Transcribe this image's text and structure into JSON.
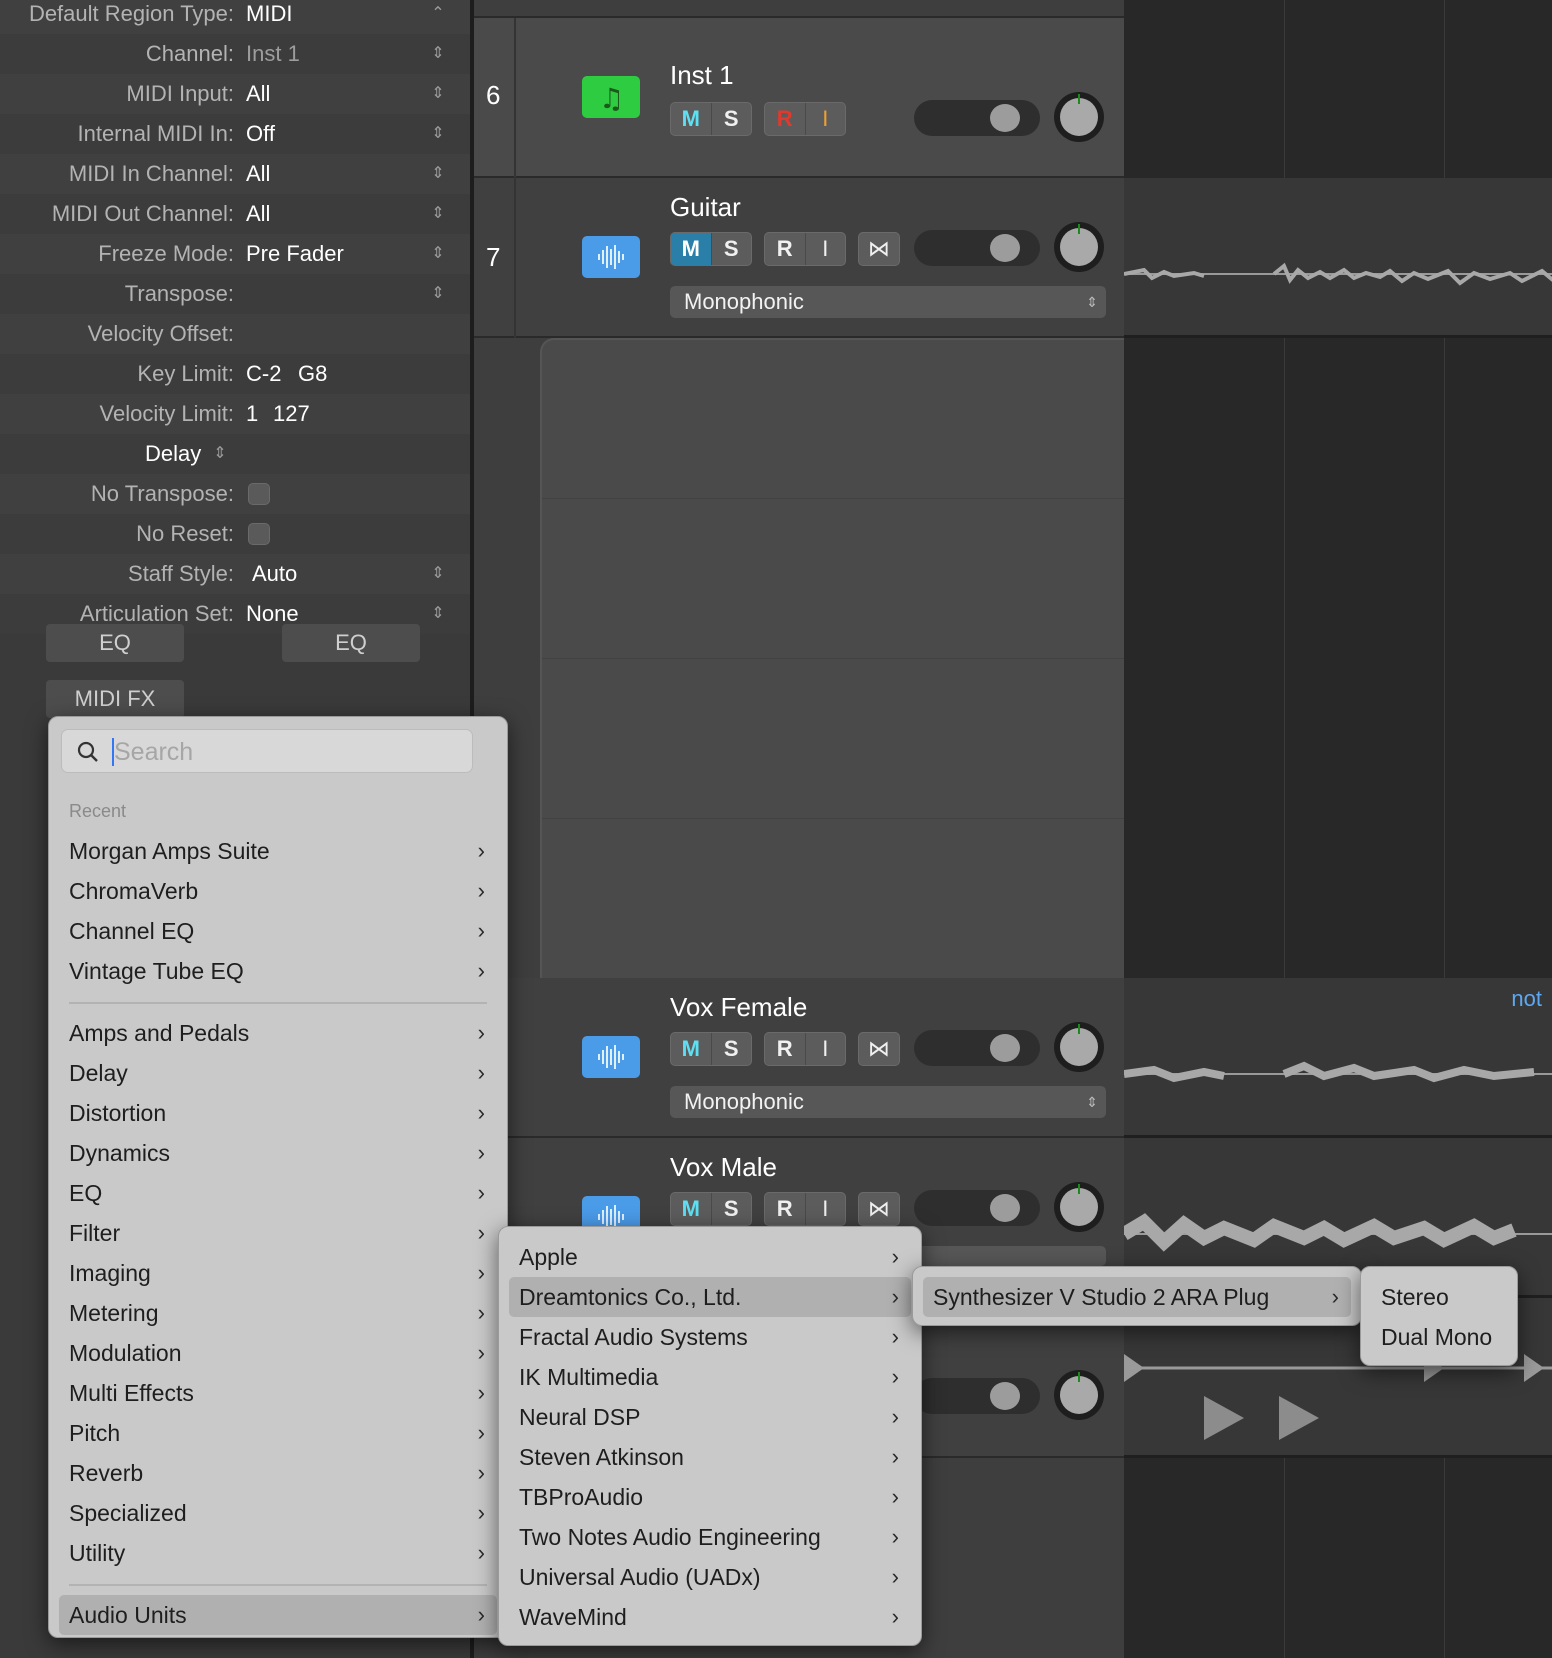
{
  "inspector": {
    "rows": [
      {
        "label": "Default Region Type:",
        "value": "MIDI"
      },
      {
        "label": "Channel:",
        "value": "Inst 1"
      },
      {
        "label": "MIDI Input:",
        "value": "All"
      },
      {
        "label": "Internal MIDI In:",
        "value": "Off"
      },
      {
        "label": "MIDI In Channel:",
        "value": "All"
      },
      {
        "label": "MIDI Out Channel:",
        "value": "All"
      },
      {
        "label": "Freeze Mode:",
        "value": "Pre Fader"
      },
      {
        "label": "Transpose:",
        "value": ""
      },
      {
        "label": "Velocity Offset:",
        "value": ""
      },
      {
        "label": "Key Limit:",
        "value": "C-2",
        "value2": "G8"
      },
      {
        "label": "Velocity Limit:",
        "value": "1",
        "value2": "127"
      },
      {
        "label": "Delay",
        "value": ""
      },
      {
        "label": "No Transpose:",
        "value": ""
      },
      {
        "label": "No Reset:",
        "value": ""
      },
      {
        "label": "Staff Style:",
        "value": "Auto"
      },
      {
        "label": "Articulation Set:",
        "value": "None"
      }
    ]
  },
  "strip": {
    "eq_left": "EQ",
    "eq_right": "EQ",
    "midi_fx": "MIDI FX"
  },
  "tracks": [
    {
      "number": "6",
      "name": "Inst 1",
      "buttons": [
        "M",
        "S",
        "R",
        "I"
      ]
    },
    {
      "number": "7",
      "name": "Guitar",
      "buttons": [
        "M",
        "S",
        "R",
        "I"
      ],
      "mode": "Monophonic"
    },
    {
      "number": "",
      "name": "Vox Female",
      "buttons": [
        "M",
        "S",
        "R",
        "I"
      ],
      "mode": "Monophonic"
    },
    {
      "number": "",
      "name": "Vox Male",
      "buttons": [
        "M",
        "S",
        "R",
        "I"
      ]
    }
  ],
  "arrange": {
    "note_text": "not"
  },
  "plugin_menu": {
    "search_placeholder": "Search",
    "recent_header": "Recent",
    "recent": [
      "Morgan Amps Suite",
      "ChromaVerb",
      "Channel EQ",
      "Vintage Tube EQ"
    ],
    "categories": [
      "Amps and Pedals",
      "Delay",
      "Distortion",
      "Dynamics",
      "EQ",
      "Filter",
      "Imaging",
      "Metering",
      "Modulation",
      "Multi Effects",
      "Pitch",
      "Reverb",
      "Specialized",
      "Utility"
    ],
    "audio_units": "Audio Units"
  },
  "vendor_menu": {
    "items": [
      "Apple",
      "Dreamtonics Co., Ltd.",
      "Fractal Audio Systems",
      "IK Multimedia",
      "Neural DSP",
      "Steven Atkinson",
      "TBProAudio",
      "Two Notes Audio Engineering",
      "Universal Audio (UADx)",
      "WaveMind"
    ],
    "selected": "Dreamtonics Co., Ltd."
  },
  "plugin_submenu": {
    "item": "Synthesizer V Studio 2 ARA Plug"
  },
  "format_menu": {
    "items": [
      "Stereo",
      "Dual Mono"
    ]
  },
  "colors": {
    "inst_icon": "#2ecc40",
    "audio_icon": "#4a9be8",
    "mute_active": "#2a9fd6",
    "mute_text": "#5ee0f2",
    "record_red": "#e03a2f",
    "input_orange": "#f0a030"
  }
}
